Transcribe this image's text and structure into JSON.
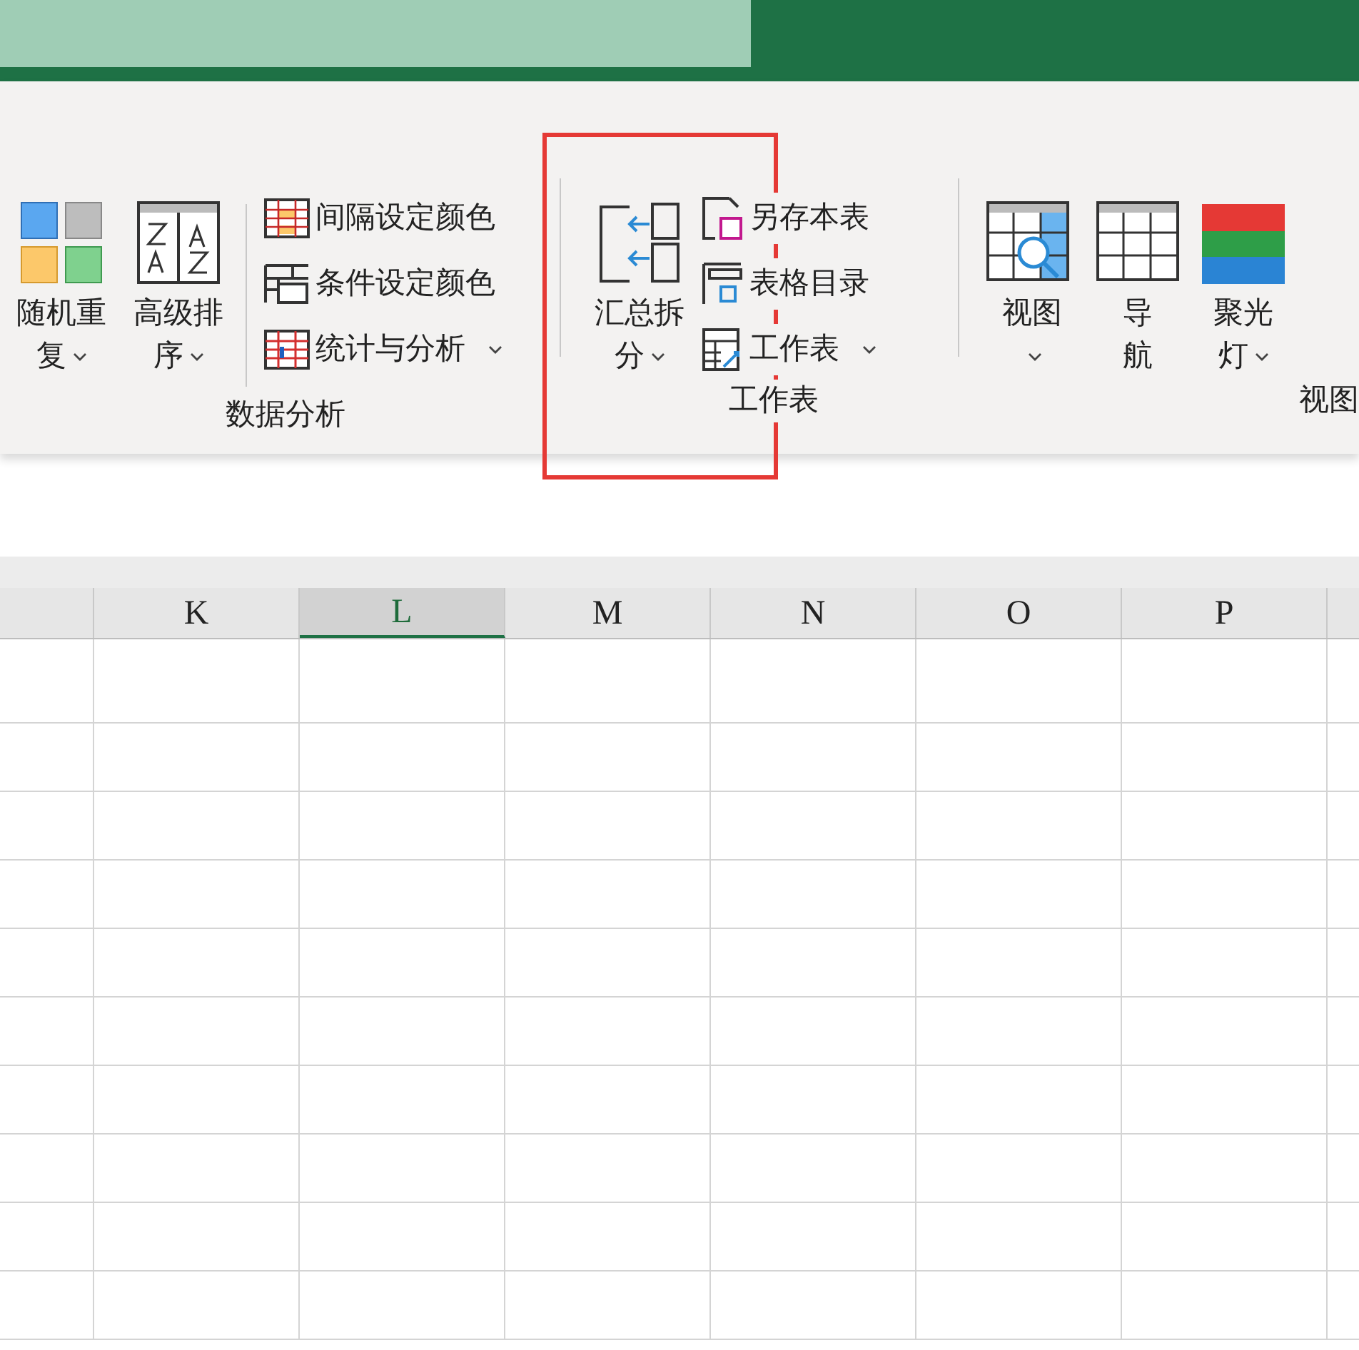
{
  "ribbon": {
    "groups": [
      {
        "label": "数据分析",
        "large_buttons": [
          {
            "label": "随机重复",
            "dropdown": true
          },
          {
            "label": "高级排序",
            "dropdown": true
          }
        ],
        "small_buttons": [
          {
            "label": "间隔设定颜色",
            "dropdown": false
          },
          {
            "label": "条件设定颜色",
            "dropdown": false
          },
          {
            "label": "统计与分析",
            "dropdown": true
          }
        ]
      },
      {
        "label": "工作表",
        "large_buttons": [
          {
            "label": "汇总拆分",
            "dropdown": true
          }
        ],
        "small_buttons": [
          {
            "label": "另存本表",
            "dropdown": false
          },
          {
            "label": "表格目录",
            "dropdown": false
          },
          {
            "label": "工作表",
            "dropdown": true
          }
        ]
      },
      {
        "label": "视图",
        "large_buttons": [
          {
            "label": "视图",
            "dropdown": true
          },
          {
            "label": "导航",
            "dropdown": false
          },
          {
            "label": "聚光灯",
            "dropdown": true
          }
        ]
      }
    ]
  },
  "sheet": {
    "columns": [
      {
        "label": "K",
        "selected": false
      },
      {
        "label": "L",
        "selected": true
      },
      {
        "label": "M",
        "selected": false
      },
      {
        "label": "N",
        "selected": false
      },
      {
        "label": "O",
        "selected": false
      },
      {
        "label": "P",
        "selected": false
      }
    ]
  }
}
